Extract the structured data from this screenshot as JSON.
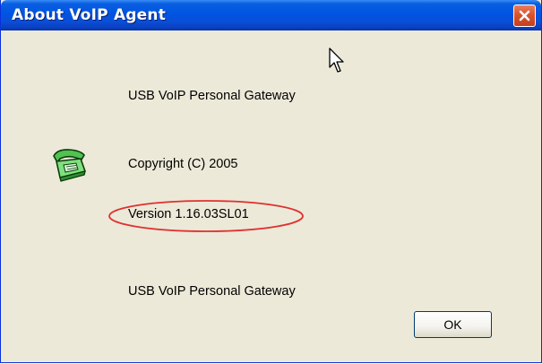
{
  "window": {
    "title": "About VoIP Agent",
    "title_bar_color": "#0054e3",
    "client_color": "#ece9d8"
  },
  "title_buttons": {
    "close_icon": "close-icon",
    "close_color": "#d9532e"
  },
  "content": {
    "product_name": "USB VoIP Personal Gateway",
    "copyright": "Copyright (C) 2005",
    "version": "Version 1.16.03SL01",
    "description": "USB VoIP Personal Gateway",
    "app_icon": "telephone-icon",
    "version_highlight_color": "#e03030"
  },
  "buttons": {
    "ok_label": "OK"
  },
  "pointer": {
    "icon": "mouse-pointer-icon"
  }
}
